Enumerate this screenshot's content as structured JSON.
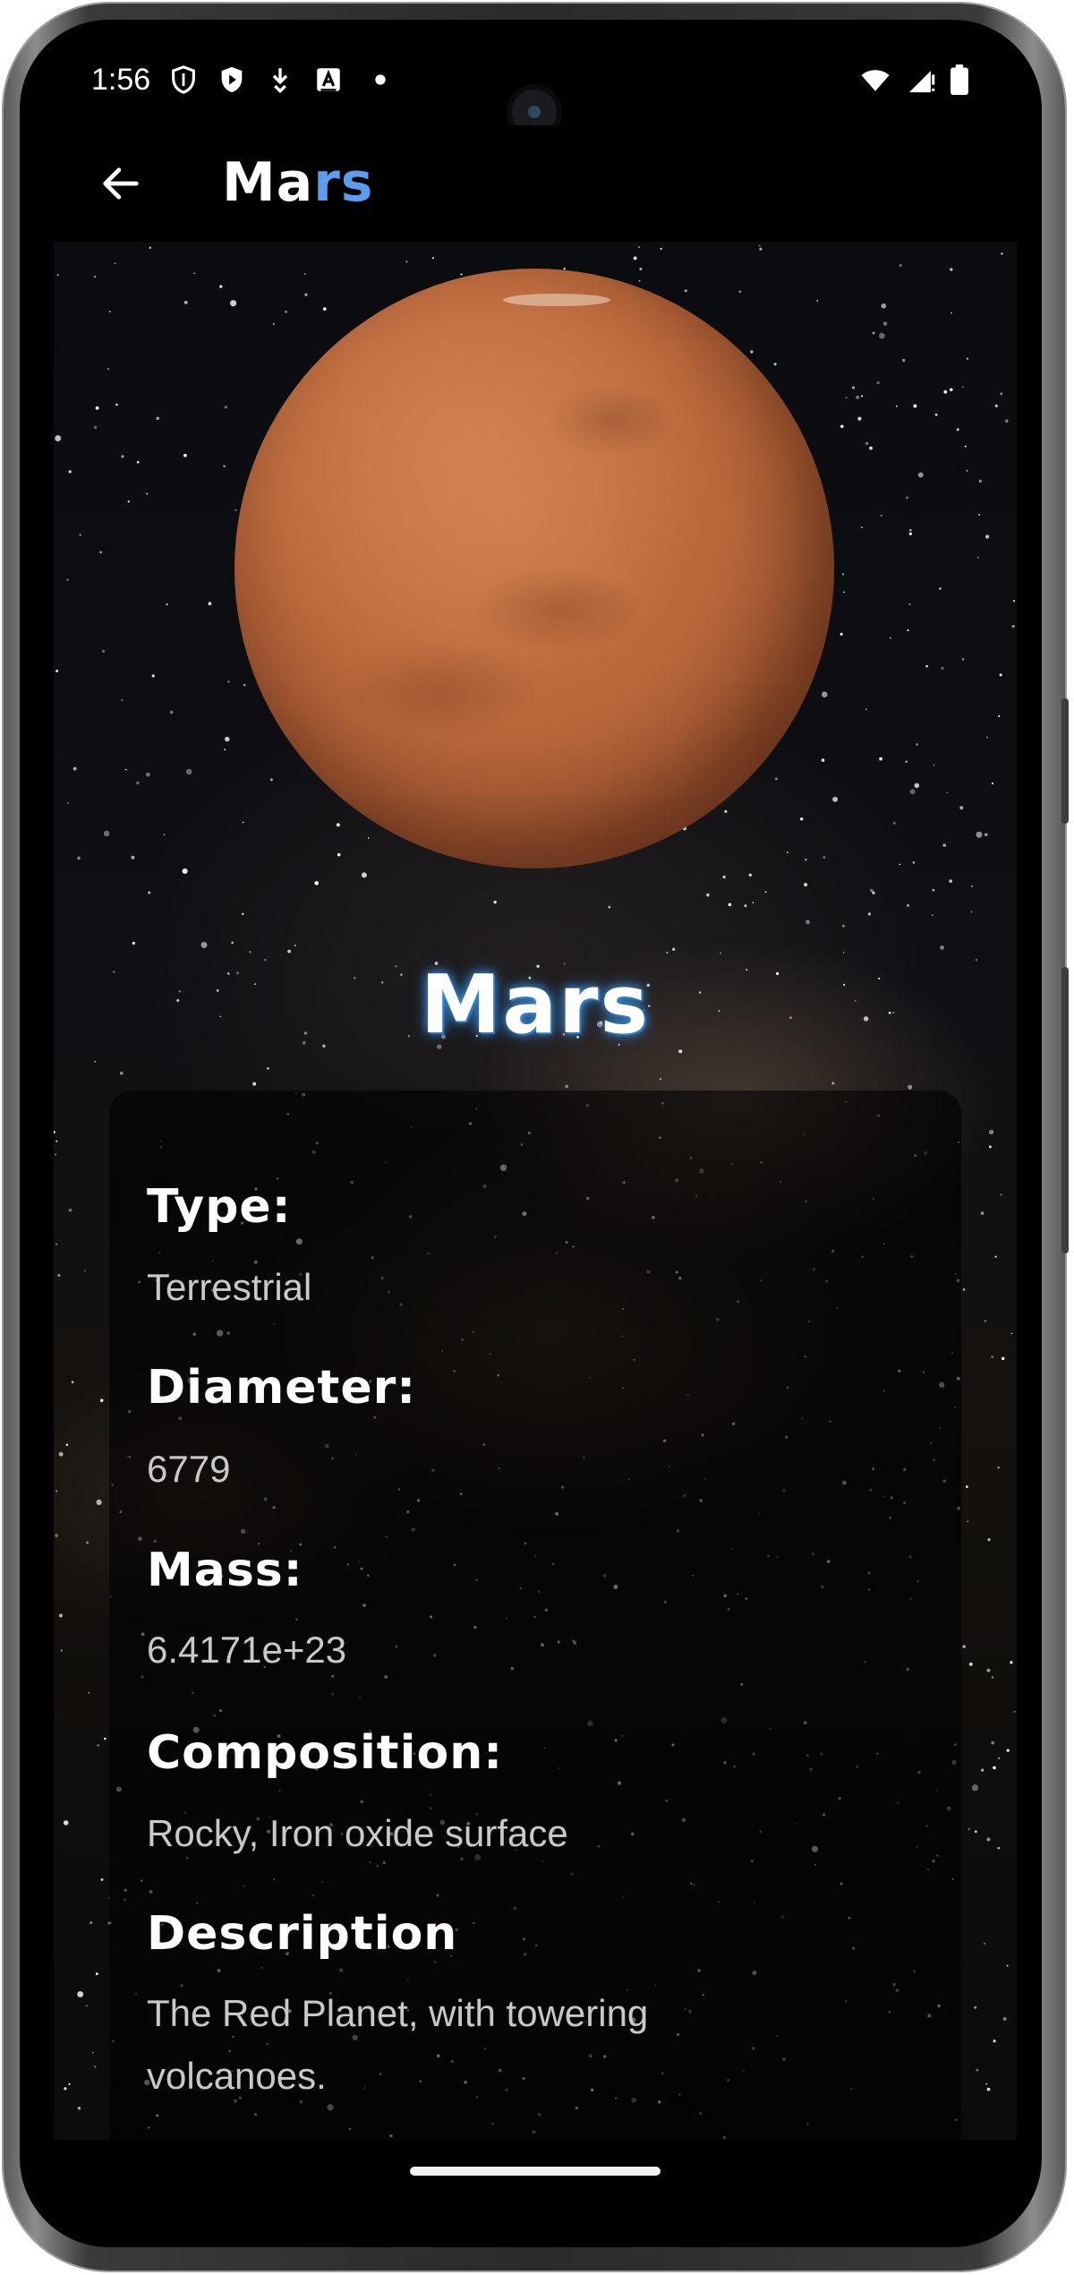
{
  "status_bar": {
    "time": "1:56",
    "icons_left": [
      "shield-icon",
      "play-protect-icon",
      "download-icon",
      "font-a-icon",
      "dot-icon"
    ],
    "icons_right": [
      "wifi-icon",
      "cellular-signal-icon",
      "battery-icon"
    ]
  },
  "app_bar": {
    "back_icon": "arrow-left-icon",
    "title_part1": "Ma",
    "title_part2": "rs",
    "title_colors": {
      "part1": "#ffffff",
      "part2": "#5e9cf0"
    }
  },
  "planet": {
    "name": "Mars",
    "image": "mars-planet-image",
    "background": "starfield-milky-way"
  },
  "details": {
    "type_label": "Type:",
    "type_value": "Terrestrial",
    "diameter_label": "Diameter:",
    "diameter_value": "6779",
    "mass_label": "Mass:",
    "mass_value": "6.4171e+23",
    "composition_label": "Composition:",
    "composition_value": "Rocky, Iron oxide surface",
    "description_label": "Description",
    "description_value": "The Red Planet, with towering volcanoes."
  },
  "colors": {
    "heading_glow": "#3f8fd8",
    "accent": "#5e9cf0",
    "text_primary": "#ffffff",
    "text_secondary": "#c9c9c9"
  }
}
